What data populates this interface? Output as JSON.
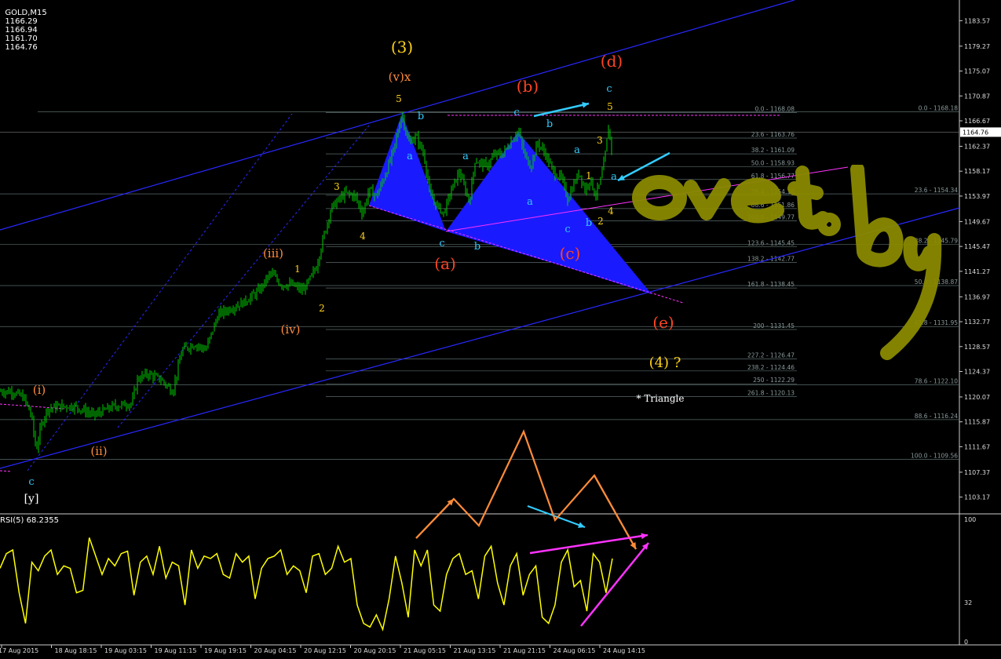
{
  "header": {
    "symbol": "GOLD,M15",
    "open": "1166.29",
    "high": "1166.94",
    "low": "1161.70",
    "close": "1164.76"
  },
  "rsi_header": "RSI(5) 68.2355",
  "watermark_text": "ovet.by",
  "colors": {
    "background": "#000000",
    "bull": "#00cc00",
    "rsi": "#ffff00",
    "channel": "#2828ff",
    "triangle": "#1a1aff",
    "magenta": "#ff33ff",
    "cyan": "#33ccff",
    "orange": "#ff8c3a",
    "red_label": "#ff4422",
    "yellow_label": "#ffd21a",
    "grid_line": "#5a6a6a",
    "watermark": "#8a8a00"
  },
  "chart_data": {
    "type": "candlestick",
    "symbol": "GOLD",
    "timeframe": "M15",
    "y_range": [
      1101.0,
      1186.0
    ],
    "y_ticks": [
      "1183.57",
      "1179.27",
      "1175.07",
      "1170.87",
      "1166.67",
      "1162.37",
      "1158.17",
      "1153.97",
      "1149.67",
      "1145.47",
      "1141.27",
      "1136.97",
      "1132.77",
      "1128.57",
      "1124.37",
      "1120.07",
      "1115.87",
      "1111.67",
      "1107.37",
      "1103.17"
    ],
    "current_price": "1164.76",
    "x_labels": [
      "17 Aug 2015",
      "18 Aug 18:15",
      "19 Aug 03:15",
      "19 Aug 11:15",
      "19 Aug 19:15",
      "20 Aug 04:15",
      "20 Aug 12:15",
      "20 Aug 20:15",
      "21 Aug 05:15",
      "21 Aug 13:15",
      "21 Aug 21:15",
      "24 Aug 06:15",
      "24 Aug 14:15"
    ],
    "price_path": [
      [
        0,
        1121
      ],
      [
        15,
        1121
      ],
      [
        30,
        1120
      ],
      [
        40,
        1117
      ],
      [
        46,
        1111
      ],
      [
        52,
        1115
      ],
      [
        60,
        1118
      ],
      [
        75,
        1118.5
      ],
      [
        95,
        1118.5
      ],
      [
        120,
        1117
      ],
      [
        145,
        1118.5
      ],
      [
        168,
        1119
      ],
      [
        175,
        1123
      ],
      [
        188,
        1124
      ],
      [
        205,
        1123
      ],
      [
        220,
        1121
      ],
      [
        232,
        1128
      ],
      [
        248,
        1129
      ],
      [
        262,
        1128
      ],
      [
        278,
        1134
      ],
      [
        293,
        1135
      ],
      [
        310,
        1136
      ],
      [
        330,
        1138
      ],
      [
        345,
        1141
      ],
      [
        358,
        1139
      ],
      [
        372,
        1139
      ],
      [
        386,
        1138
      ],
      [
        395,
        1140
      ],
      [
        403,
        1142
      ],
      [
        412,
        1147
      ],
      [
        422,
        1152
      ],
      [
        440,
        1154.5
      ],
      [
        452,
        1154
      ],
      [
        462,
        1151
      ],
      [
        470,
        1155
      ],
      [
        480,
        1154
      ],
      [
        492,
        1158
      ],
      [
        502,
        1162
      ],
      [
        512,
        1168
      ],
      [
        520,
        1163
      ],
      [
        530,
        1164
      ],
      [
        540,
        1161
      ],
      [
        548,
        1154
      ],
      [
        556,
        1152.5
      ],
      [
        565,
        1151
      ],
      [
        575,
        1155
      ],
      [
        585,
        1158
      ],
      [
        598,
        1153
      ],
      [
        605,
        1160
      ],
      [
        620,
        1159
      ],
      [
        630,
        1161
      ],
      [
        640,
        1161
      ],
      [
        650,
        1163
      ],
      [
        660,
        1165
      ],
      [
        668,
        1161
      ],
      [
        676,
        1159
      ],
      [
        685,
        1163
      ],
      [
        695,
        1161
      ],
      [
        705,
        1158
      ],
      [
        715,
        1157
      ],
      [
        723,
        1153.5
      ],
      [
        731,
        1156
      ],
      [
        738,
        1158
      ],
      [
        745,
        1155
      ],
      [
        752,
        1157
      ],
      [
        758,
        1154
      ],
      [
        764,
        1156
      ],
      [
        770,
        1160
      ],
      [
        775,
        1165.5
      ],
      [
        779,
        1162
      ]
    ],
    "rsi": {
      "name": "RSI(5)",
      "value": 68.2355,
      "y_range": [
        0,
        100
      ],
      "y_ticks": [
        "100",
        "32",
        "0"
      ],
      "values": [
        60,
        72,
        75,
        40,
        15,
        65,
        58,
        70,
        75,
        55,
        62,
        60,
        40,
        42,
        85,
        70,
        55,
        68,
        62,
        72,
        74,
        38,
        65,
        70,
        55,
        78,
        52,
        65,
        62,
        30,
        75,
        60,
        70,
        68,
        72,
        55,
        52,
        72,
        65,
        70,
        35,
        60,
        68,
        70,
        75,
        55,
        62,
        58,
        40,
        70,
        72,
        55,
        60,
        78,
        65,
        68,
        30,
        15,
        12,
        22,
        10,
        35,
        70,
        48,
        20,
        75,
        62,
        75,
        30,
        25,
        55,
        68,
        72,
        55,
        58,
        35,
        70,
        78,
        48,
        30,
        62,
        72,
        38,
        55,
        62,
        20,
        15,
        30,
        65,
        75,
        45,
        50,
        25,
        72,
        65,
        40,
        68
      ]
    },
    "fib_levels": [
      {
        "label": "0.0 - 1168.08",
        "price": 1168.08
      },
      {
        "label": "23.6 - 1163.76",
        "price": 1163.76
      },
      {
        "label": "38.2 - 1161.09",
        "price": 1161.09
      },
      {
        "label": "50.0 - 1158.93",
        "price": 1158.93
      },
      {
        "label": "61.8 - 1156.77",
        "price": 1156.77
      },
      {
        "label": "76.4 - 1154.10",
        "price": 1154.1
      },
      {
        "label": "88.6 - 1151.86",
        "price": 1151.86
      },
      {
        "label": "100.0 - 1149.77",
        "price": 1149.77
      },
      {
        "label": "123.6 - 1145.45",
        "price": 1145.45
      },
      {
        "label": "138.2 - 1142.77",
        "price": 1142.77
      },
      {
        "label": "161.8 - 1138.45",
        "price": 1138.45
      },
      {
        "label": "200 - 1131.45",
        "price": 1131.45
      },
      {
        "label": "227.2 - 1126.47",
        "price": 1126.47
      },
      {
        "label": "238.2 - 1124.46",
        "price": 1124.46
      },
      {
        "label": "250 - 1122.29",
        "price": 1122.29
      },
      {
        "label": "261.8 - 1120.13",
        "price": 1120.13
      }
    ],
    "fib_levels_right": [
      {
        "label": "0.0 - 1168.18",
        "price": 1168.18
      },
      {
        "label": "23.6 - 1154.34",
        "price": 1154.34
      },
      {
        "label": "38.2 - 1145.79",
        "price": 1145.79
      },
      {
        "label": "50.0 - 1138.87",
        "price": 1138.87
      },
      {
        "label": "61.8 - 1131.95",
        "price": 1131.95
      },
      {
        "label": "78.6 - 1122.10",
        "price": 1122.1
      },
      {
        "label": "88.6 - 1116.24",
        "price": 1116.24
      },
      {
        "label": "100.0 - 1109.56",
        "price": 1109.56
      }
    ],
    "wave_labels": [
      {
        "text": "(3)",
        "color": "yellow"
      },
      {
        "text": "(v)x",
        "color": "orange"
      },
      {
        "text": "5",
        "color": "yellow"
      },
      {
        "text": "b",
        "color": "cyan"
      },
      {
        "text": "a",
        "color": "cyan"
      },
      {
        "text": "3",
        "color": "yellow"
      },
      {
        "text": "4",
        "color": "yellow"
      },
      {
        "text": "(b)",
        "color": "red"
      },
      {
        "text": "c",
        "color": "cyan"
      },
      {
        "text": "b",
        "color": "cyan"
      },
      {
        "text": "a",
        "color": "cyan"
      },
      {
        "text": "a",
        "color": "cyan"
      },
      {
        "text": "(d)",
        "color": "red"
      },
      {
        "text": "c",
        "color": "cyan"
      },
      {
        "text": "5",
        "color": "yellow"
      },
      {
        "text": "3",
        "color": "yellow"
      },
      {
        "text": "a",
        "color": "cyan"
      },
      {
        "text": "1",
        "color": "yellow"
      },
      {
        "text": "a",
        "color": "cyan"
      },
      {
        "text": "4",
        "color": "yellow"
      },
      {
        "text": "2",
        "color": "yellow"
      },
      {
        "text": "b",
        "color": "cyan"
      },
      {
        "text": "c",
        "color": "cyan"
      },
      {
        "text": "c",
        "color": "cyan"
      },
      {
        "text": "b",
        "color": "cyan"
      },
      {
        "text": "(a)",
        "color": "red"
      },
      {
        "text": "(c)",
        "color": "red"
      },
      {
        "text": "(iii)",
        "color": "orange"
      },
      {
        "text": "1",
        "color": "yellow"
      },
      {
        "text": "2",
        "color": "yellow"
      },
      {
        "text": "(iv)",
        "color": "orange"
      },
      {
        "text": "(e)",
        "color": "red"
      },
      {
        "text": "(4) ?",
        "color": "yellow"
      },
      {
        "text": "* Triangle",
        "color": "white"
      },
      {
        "text": "(i)",
        "color": "orange"
      },
      {
        "text": "(ii)",
        "color": "orange"
      },
      {
        "text": "c",
        "color": "cyan"
      },
      {
        "text": "[y]",
        "color": "white"
      }
    ]
  }
}
